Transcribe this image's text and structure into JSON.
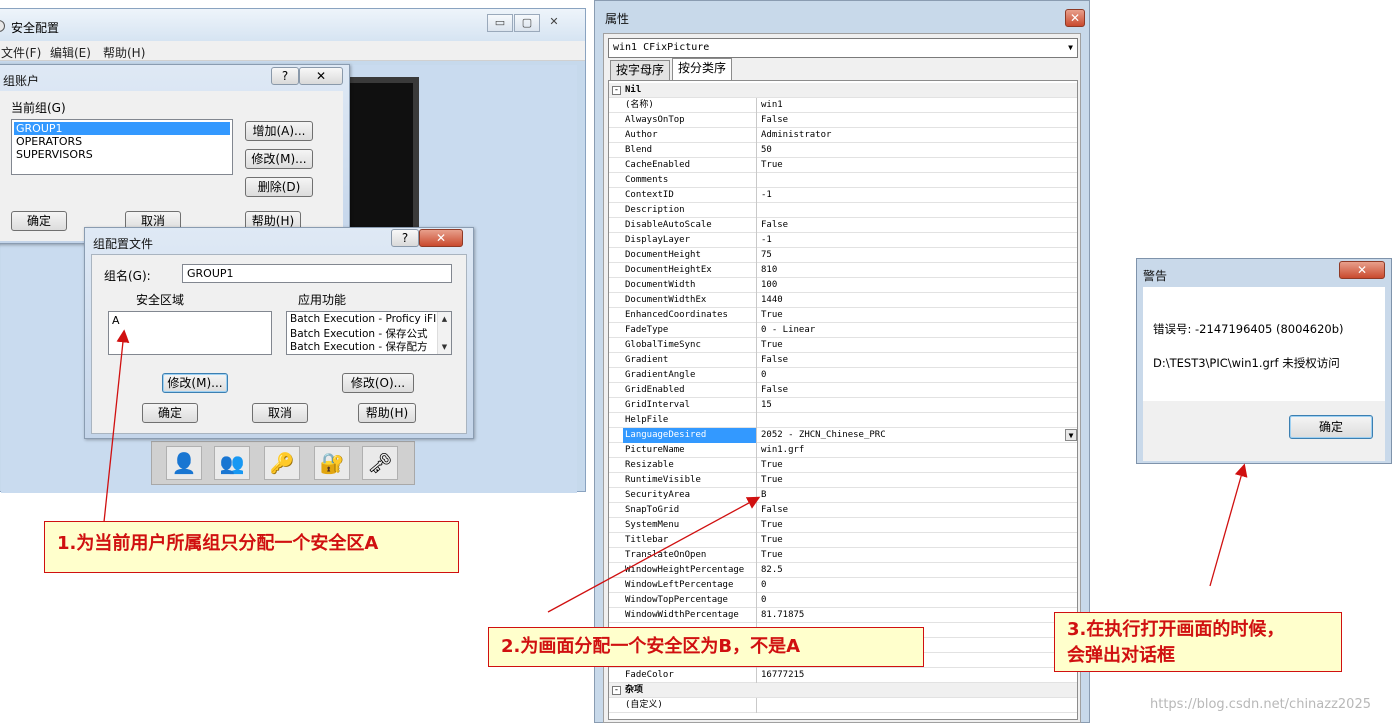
{
  "main_window": {
    "title": "安全配置",
    "menu": [
      "文件(F)",
      "编辑(E)",
      "帮助(H)"
    ],
    "caption_min": "▭",
    "caption_max": "▢",
    "caption_close": "✕"
  },
  "group_account_dialog": {
    "title": "组账户",
    "help_btn": "?",
    "close_btn": "✕",
    "current_group_label": "当前组(G)",
    "groups": [
      "GROUP1",
      "OPERATORS",
      "SUPERVISORS"
    ],
    "add_btn": "增加(A)...",
    "modify_btn": "修改(M)...",
    "delete_btn": "删除(D)",
    "ok_btn": "确定",
    "cancel_btn": "取消",
    "help_label_btn": "帮助(H)"
  },
  "group_config_dialog": {
    "title": "组配置文件",
    "help_btn": "?",
    "close_btn": "✕",
    "group_name_label": "组名(G):",
    "group_name_value": "GROUP1",
    "security_area_label": "安全区域",
    "app_function_label": "应用功能",
    "security_areas": [
      "A"
    ],
    "app_functions": [
      "Batch Execution - Proficy iFIX",
      "Batch Execution - 保存公式",
      "Batch Execution - 保存配方"
    ],
    "modify_m_btn": "修改(M)...",
    "modify_o_btn": "修改(O)...",
    "ok_btn": "确定",
    "cancel_btn": "取消",
    "help_label_btn": "帮助(H)"
  },
  "properties": {
    "title": "属性",
    "close_btn": "✕",
    "object_selector": "win1 CFixPicture",
    "tabs": [
      "按字母序",
      "按分类序"
    ],
    "rows": [
      {
        "name": "Nil",
        "value": "",
        "category": true
      },
      {
        "name": "(名称)",
        "value": "win1"
      },
      {
        "name": "AlwaysOnTop",
        "value": "False"
      },
      {
        "name": "Author",
        "value": "Administrator"
      },
      {
        "name": "Blend",
        "value": "50"
      },
      {
        "name": "CacheEnabled",
        "value": "True"
      },
      {
        "name": "Comments",
        "value": ""
      },
      {
        "name": "ContextID",
        "value": "-1"
      },
      {
        "name": "Description",
        "value": ""
      },
      {
        "name": "DisableAutoScale",
        "value": "False"
      },
      {
        "name": "DisplayLayer",
        "value": "-1"
      },
      {
        "name": "DocumentHeight",
        "value": "75"
      },
      {
        "name": "DocumentHeightEx",
        "value": "810"
      },
      {
        "name": "DocumentWidth",
        "value": "100"
      },
      {
        "name": "DocumentWidthEx",
        "value": "1440"
      },
      {
        "name": "EnhancedCoordinates",
        "value": "True"
      },
      {
        "name": "FadeType",
        "value": "0 - Linear"
      },
      {
        "name": "GlobalTimeSync",
        "value": "True"
      },
      {
        "name": "Gradient",
        "value": "False"
      },
      {
        "name": "GradientAngle",
        "value": "0"
      },
      {
        "name": "GridEnabled",
        "value": "False"
      },
      {
        "name": "GridInterval",
        "value": "15"
      },
      {
        "name": "HelpFile",
        "value": ""
      },
      {
        "name": "LanguageDesired",
        "value": "2052 - ZHCN_Chinese_PRC",
        "selected": true
      },
      {
        "name": "PictureName",
        "value": "win1.grf"
      },
      {
        "name": "Resizable",
        "value": "True"
      },
      {
        "name": "RuntimeVisible",
        "value": "True"
      },
      {
        "name": "SecurityArea",
        "value": "B"
      },
      {
        "name": "SnapToGrid",
        "value": "False"
      },
      {
        "name": "SystemMenu",
        "value": "True"
      },
      {
        "name": "Titlebar",
        "value": "True"
      },
      {
        "name": "TranslateOnOpen",
        "value": "True"
      },
      {
        "name": "WindowHeightPercentage",
        "value": "82.5"
      },
      {
        "name": "WindowLeftPercentage",
        "value": "0"
      },
      {
        "name": "WindowTopPercentage",
        "value": "0"
      },
      {
        "name": "WindowWidthPercentage",
        "value": "81.71875"
      },
      {
        "name": "",
        "value": ""
      },
      {
        "name": "",
        "value": ""
      },
      {
        "name": "",
        "value": ""
      },
      {
        "name": "FadeColor",
        "value": "16777215"
      },
      {
        "name": "杂项",
        "value": "",
        "category": true
      },
      {
        "name": "(自定义)",
        "value": ""
      }
    ]
  },
  "warning_dialog": {
    "title": "警告",
    "close_btn": "✕",
    "error_line": "错误号: -2147196405 (8004620b)",
    "message_line": "D:\\TEST3\\PIC\\win1.grf 未授权访问",
    "ok_btn": "确定"
  },
  "annotations": {
    "note1": "1.为当前用户所属组只分配一个安全区A",
    "note2": "2.为画面分配一个安全区为B，不是A",
    "note3_line1": "3.在执行打开画面的时候，",
    "note3_line2": "会弹出对话框",
    "color": "#d01010"
  },
  "watermark": "https://blog.csdn.net/chinazz2025"
}
